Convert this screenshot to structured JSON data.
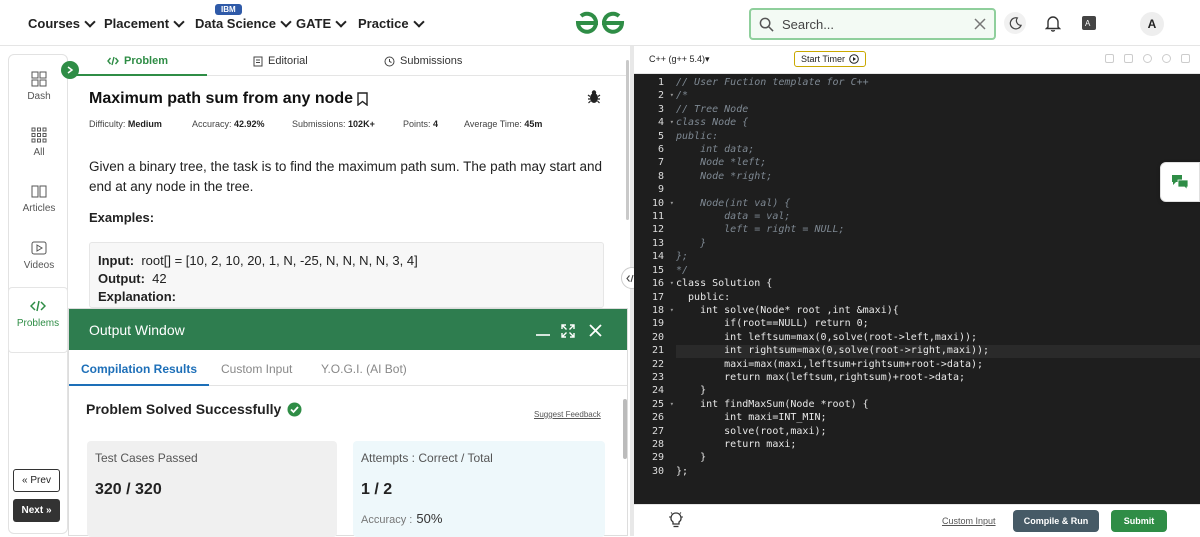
{
  "nav": {
    "items": [
      "Courses",
      "Placement",
      "Data Science",
      "GATE",
      "Practice"
    ],
    "ibm_badge": "IBM",
    "search_placeholder": "Search...",
    "avatar": "A"
  },
  "rail": {
    "items": [
      {
        "label": "Dash",
        "icon": "dashboard-icon"
      },
      {
        "label": "All",
        "icon": "grid-icon"
      },
      {
        "label": "Articles",
        "icon": "book-icon"
      },
      {
        "label": "Videos",
        "icon": "video-icon"
      },
      {
        "label": "Problems",
        "icon": "code-icon"
      }
    ],
    "prev": "« Prev",
    "next": "Next »"
  },
  "problem": {
    "tabs": [
      "Problem",
      "Editorial",
      "Submissions"
    ],
    "title": "Maximum path sum from any node",
    "meta": {
      "difficulty_label": "Difficulty:",
      "difficulty": "Medium",
      "accuracy_label": "Accuracy:",
      "accuracy": "42.92%",
      "submissions_label": "Submissions:",
      "submissions": "102K+",
      "points_label": "Points:",
      "points": "4",
      "time_label": "Average Time:",
      "time": "45m"
    },
    "description": "Given a binary tree, the task is to find the maximum path sum. The path may start and end at any node in the tree.",
    "examples_heading": "Examples:",
    "example": {
      "input_label": "Input:",
      "input": "root[] = [10, 2, 10, 20, 1, N, -25, N, N, N, N, 3, 4]",
      "output_label": "Output:",
      "output": "42",
      "explanation_label": "Explanation:"
    }
  },
  "output_window": {
    "title": "Output Window",
    "tabs": [
      "Compilation Results",
      "Custom Input",
      "Y.O.G.I. (AI Bot)"
    ],
    "status": "Problem Solved Successfully",
    "feedback": "Suggest Feedback",
    "tests_label": "Test Cases Passed",
    "tests_value": "320 / 320",
    "attempts_label": "Attempts : Correct / Total",
    "attempts_value": "1 / 2",
    "accuracy_label": "Accuracy :",
    "accuracy_value": "50%"
  },
  "editor": {
    "language": "C++ (g++ 5.4)▾",
    "timer": "Start Timer",
    "lines": [
      "// User Fuction template for C++",
      "/*",
      "// Tree Node",
      "class Node {",
      "public:",
      "    int data;",
      "    Node *left;",
      "    Node *right;",
      "",
      "    Node(int val) {",
      "        data = val;",
      "        left = right = NULL;",
      "    }",
      "};",
      "*/",
      "class Solution {",
      "  public:",
      "    int solve(Node* root ,int &maxi){",
      "        if(root==NULL) return 0;",
      "        int leftsum=max(0,solve(root->left,maxi));",
      "        int rightsum=max(0,solve(root->right,maxi));",
      "        maxi=max(maxi,leftsum+rightsum+root->data);",
      "        return max(leftsum,rightsum)+root->data;",
      "    }",
      "    int findMaxSum(Node *root) {",
      "        int maxi=INT_MIN;",
      "        solve(root,maxi);",
      "        return maxi;",
      "    }",
      "};"
    ],
    "custom_input": "Custom Input",
    "compile": "Compile & Run",
    "submit": "Submit"
  },
  "colors": {
    "brand": "#2f8d46",
    "output_header": "#2e7d4f",
    "tab_active": "#1d6fb8"
  }
}
